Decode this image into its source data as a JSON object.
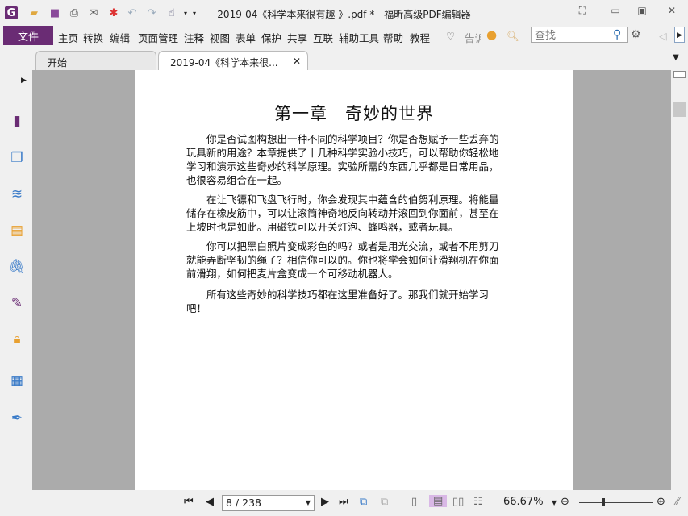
{
  "window": {
    "title": "2019-04《科学本来很有趣 》.pdf * - 福昕高级PDF编辑器"
  },
  "menu": {
    "file": "文件",
    "items": [
      "主页",
      "转换",
      "编辑",
      "页面管理",
      "注释",
      "视图",
      "表单",
      "保护",
      "共享",
      "互联",
      "辅助工具",
      "帮助",
      "教程"
    ],
    "tell": "告诉",
    "search_placeholder": "查找"
  },
  "tabs": [
    {
      "label": "开始"
    },
    {
      "label": "2019-04《科学本来很..."
    }
  ],
  "document": {
    "heading": "第一章　奇妙的世界",
    "paragraphs": [
      [
        "　　你是否试图构想出一种不同的科学项目？你是否想赋予一些丢弃的",
        "玩具新的用途？本章提供了十几种科学实验小技巧，可以帮助你轻松地",
        "学习和演示这些奇妙的科学原理。实验所需的东西几乎都是日常用品，",
        "也很容易组合在一起。"
      ],
      [
        "　　在让飞镖和飞盘飞行时，你会发现其中蕴含的伯努利原理。将能量",
        "储存在橡皮筋中，可以让滚筒神奇地反向转动并滚回到你面前，甚至在",
        "上坡时也是如此。用磁铁可以开关灯泡、蜂鸣器，或者玩具。"
      ],
      [
        "　　你可以把黑白照片变成彩色的吗？或者是用光交流，或者不用剪刀",
        "就能弄断坚韧的绳子？相信你可以的。你也将学会如何让滑翔机在你面",
        "前滑翔，如何把麦片盒变成一个可移动机器人。"
      ],
      [
        "　　所有这些奇妙的科学技巧都在这里准备好了。那我们就开始学习",
        "吧！"
      ]
    ]
  },
  "status": {
    "page": "8 / 238",
    "zoom": "66.67%",
    "zoom_slider_fraction": 0.4
  },
  "colors": {
    "brand": "#6a2c74",
    "active_view": "#d9b8e6"
  }
}
